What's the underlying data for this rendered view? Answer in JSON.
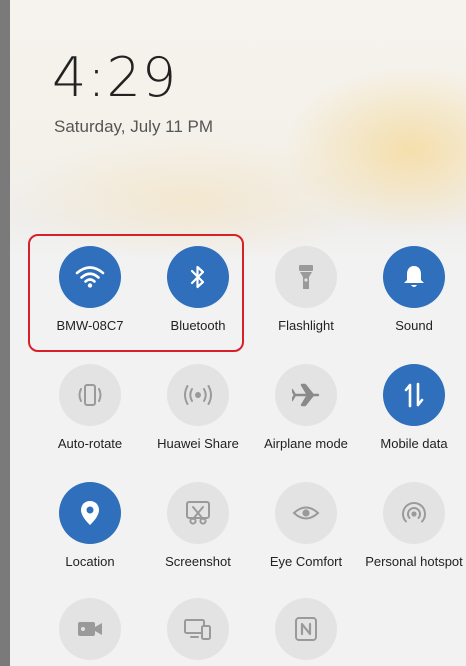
{
  "clock": {
    "time": "4:29",
    "date": "Saturday, July 11  PM"
  },
  "tiles": [
    {
      "id": "wifi",
      "label": "BMW-08C7",
      "icon": "wifi-icon",
      "active": true
    },
    {
      "id": "bluetooth",
      "label": "Bluetooth",
      "icon": "bluetooth-icon",
      "active": true
    },
    {
      "id": "flashlight",
      "label": "Flashlight",
      "icon": "flashlight-icon",
      "active": false
    },
    {
      "id": "sound",
      "label": "Sound",
      "icon": "bell-icon",
      "active": true
    },
    {
      "id": "auto-rotate",
      "label": "Auto-rotate",
      "icon": "auto-rotate-icon",
      "active": false
    },
    {
      "id": "huawei-share",
      "label": "Huawei Share",
      "icon": "share-waves-icon",
      "active": false
    },
    {
      "id": "airplane",
      "label": "Airplane mode",
      "icon": "airplane-icon",
      "active": false
    },
    {
      "id": "mobile-data",
      "label": "Mobile data",
      "icon": "mobile-data-arrows-icon",
      "active": true
    },
    {
      "id": "location",
      "label": "Location",
      "icon": "location-pin-icon",
      "active": true
    },
    {
      "id": "screenshot",
      "label": "Screenshot",
      "icon": "screenshot-scissors-icon",
      "active": false
    },
    {
      "id": "eye-comfort",
      "label": "Eye Comfort",
      "icon": "eye-icon",
      "active": false
    },
    {
      "id": "personal-hotspot",
      "label": "Personal hotspot",
      "icon": "hotspot-icon",
      "active": false
    },
    {
      "id": "screen-recorder",
      "label": "",
      "icon": "video-camera-icon",
      "active": false
    },
    {
      "id": "multi-screen",
      "label": "",
      "icon": "multi-screen-icon",
      "active": false
    },
    {
      "id": "nfc",
      "label": "",
      "icon": "nfc-icon",
      "active": false
    }
  ],
  "colors": {
    "active": "#2f6fbb",
    "inactive": "#e3e3e3",
    "highlight_border": "#d8202a"
  }
}
